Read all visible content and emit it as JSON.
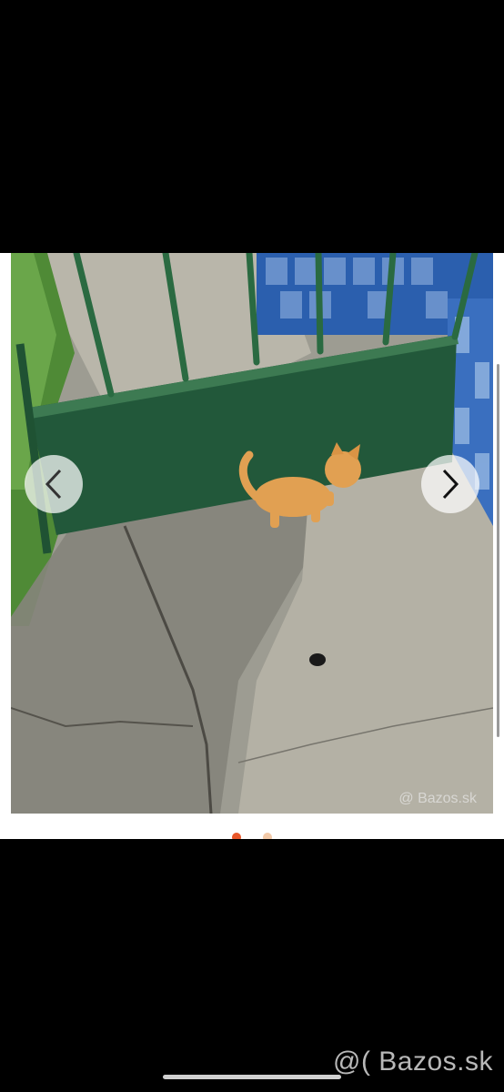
{
  "viewer": {
    "photo_watermark": "@ Bazos.sk",
    "nav": {
      "prev_icon": "chevron-left-icon",
      "next_icon": "chevron-right-icon"
    },
    "indicator": {
      "count": 2,
      "active_index": 0
    }
  },
  "footer": {
    "watermark": "@( Bazos.sk"
  },
  "colors": {
    "background": "#000000",
    "viewer_bg": "#ffffff",
    "active_dot": "#e8572a",
    "inactive_dot": "#f2c9a8"
  }
}
